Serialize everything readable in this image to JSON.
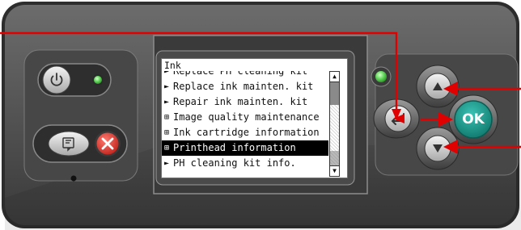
{
  "screen": {
    "title": "Ink",
    "items": [
      {
        "prefix": "►",
        "label": "Replace PH cleaning kit",
        "selected": false
      },
      {
        "prefix": "►",
        "label": "Replace ink mainten. kit",
        "selected": false
      },
      {
        "prefix": "►",
        "label": "Repair ink mainten. kit",
        "selected": false
      },
      {
        "prefix": "⊞",
        "label": "Image quality maintenance",
        "selected": false
      },
      {
        "prefix": "⊞",
        "label": "Ink cartridge information",
        "selected": false
      },
      {
        "prefix": "⊞",
        "label": "Printhead information",
        "selected": true
      },
      {
        "prefix": "►",
        "label": "PH cleaning kit info.",
        "selected": false
      }
    ],
    "scroll_up_glyph": "▲",
    "scroll_down_glyph": "▼"
  },
  "buttons": {
    "ok_label": "OK",
    "power_icon": "power-icon",
    "help_icon": "help-icon",
    "cancel_icon": "cancel-x-icon",
    "back_icon": "back-arrow-icon",
    "up_icon": "up-arrow-icon",
    "down_icon": "down-arrow-icon"
  },
  "colors": {
    "panel": "#5a5a5a",
    "ok_button": "#1a9a8e",
    "cancel_button": "#e0433a",
    "led_green": "#6fe36a",
    "callout_line": "#e00000"
  }
}
